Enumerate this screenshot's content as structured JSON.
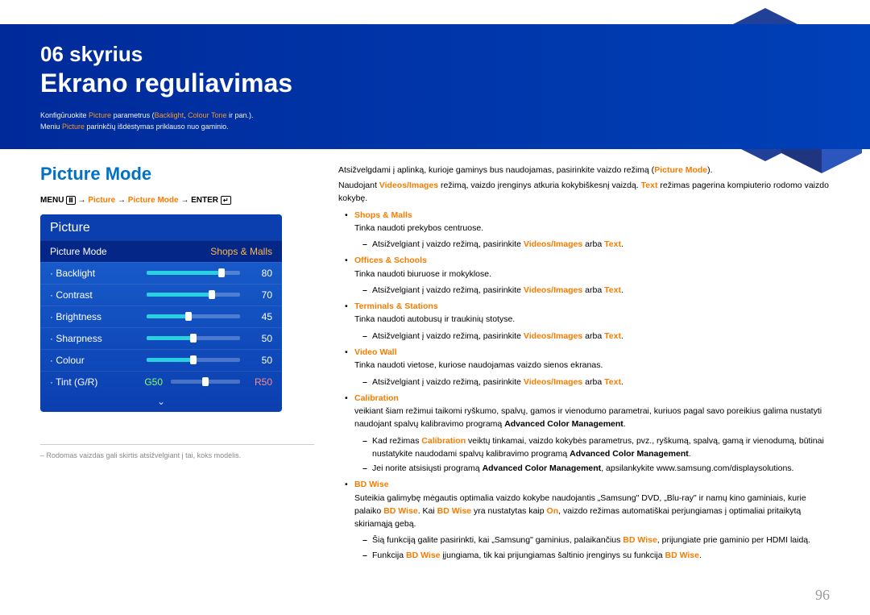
{
  "chapter": {
    "num": "06 skyrius",
    "name": "Ekrano reguliavimas"
  },
  "intro": {
    "line1_a": "Konfigūruokite ",
    "line1_b": " parametrus (",
    "line1_c": ", ",
    "line1_d": " ir pan.).",
    "line2_a": "Meniu ",
    "line2_b": " parinkčių išdėstymas priklauso nuo gaminio.",
    "picture": "Picture",
    "backlight": "Backlight",
    "colourtone": "Colour Tone"
  },
  "section_title": "Picture Mode",
  "menu_path": {
    "menu": "MENU ",
    "arrow": " → ",
    "picture": "Picture",
    "picture_mode": "Picture Mode",
    "enter": "ENTER "
  },
  "menu": {
    "header": "Picture",
    "mode_label": "Picture Mode",
    "mode_value": "Shops & Malls",
    "items": [
      {
        "label": "Backlight",
        "value": "80",
        "pct": 80
      },
      {
        "label": "Contrast",
        "value": "70",
        "pct": 70
      },
      {
        "label": "Brightness",
        "value": "45",
        "pct": 45
      },
      {
        "label": "Sharpness",
        "value": "50",
        "pct": 50
      },
      {
        "label": "Colour",
        "value": "50",
        "pct": 50
      }
    ],
    "tint": {
      "label": "Tint (G/R)",
      "g": "G50",
      "r": "R50"
    },
    "chevron": "⌄"
  },
  "footnote": "– Rodomas vaizdas gali skirtis atsižvelgiant į tai, koks modelis.",
  "right": {
    "p1_a": "Atsižvelgdami į aplinką, kurioje gaminys bus naudojamas, pasirinkite vaizdo režimą (",
    "p1_b": ").",
    "picture_mode": "Picture Mode",
    "p2_a": "Naudojant ",
    "p2_b": " režimą, vaizdo įrenginys atkuria kokybiškesnį vaizdą. ",
    "p2_c": " režimas pagerina kompiuterio rodomo vaizdo kokybę.",
    "videos_images": "Videos/Images",
    "text": "Text",
    "shops_malls": "Shops & Malls",
    "shops_malls_desc": "Tinka naudoti prekybos centruose.",
    "sub_a": "Atsižvelgiant į vaizdo režimą, pasirinkite ",
    "sub_b": " arba ",
    "sub_c": ".",
    "offices_schools": "Offices & Schools",
    "offices_desc": "Tinka naudoti biuruose ir mokyklose.",
    "terminals": "Terminals & Stations",
    "terminals_desc": "Tinka naudoti autobusų ir traukinių stotyse.",
    "video_wall": "Video Wall",
    "video_wall_desc": "Tinka naudoti vietose, kuriose naudojamas vaizdo sienos ekranas.",
    "calibration": "Calibration",
    "calib_desc_a": "veikiant šiam režimui taikomi ryškumo, spalvų, gamos ir vienodumo parametrai, kuriuos pagal savo poreikius galima nustatyti naudojant spalvų kalibravimo programą ",
    "acm": "Advanced Color Management",
    "calib_n1_a": "Kad režimas ",
    "calib_n1_b": " veiktų tinkamai, vaizdo kokybės parametrus, pvz., ryškumą, spalvą, gamą ir vienodumą, būtinai nustatykite naudodami spalvų kalibravimo programą ",
    "calib_n2_a": "Jei norite atsisiųsti programą ",
    "calib_n2_b": ", apsilankykite www.samsung.com/displaysolutions.",
    "bdwise": "BD Wise",
    "bdwise_desc_a": "Suteikia galimybę mėgautis optimalia vaizdo kokybe naudojantis „Samsung\" DVD, „Blu-ray\" ir namų kino gaminiais, kurie palaiko ",
    "bdwise_desc_b": ". Kai ",
    "bdwise_desc_c": " yra nustatytas kaip ",
    "on": "On",
    "bdwise_desc_d": ", vaizdo režimas automatiškai perjungiamas į optimaliai pritaikytą skiriamąją gebą.",
    "bdwise_n1_a": "Šią funkciją galite pasirinkti, kai „Samsung\" gaminius, palaikančius ",
    "bdwise_n1_b": ", prijungiate prie gaminio per HDMI laidą.",
    "bdwise_n2_a": "Funkcija ",
    "bdwise_n2_b": " įjungiama, tik kai prijungiamas šaltinio įrenginys su funkcija "
  },
  "page_number": "96"
}
